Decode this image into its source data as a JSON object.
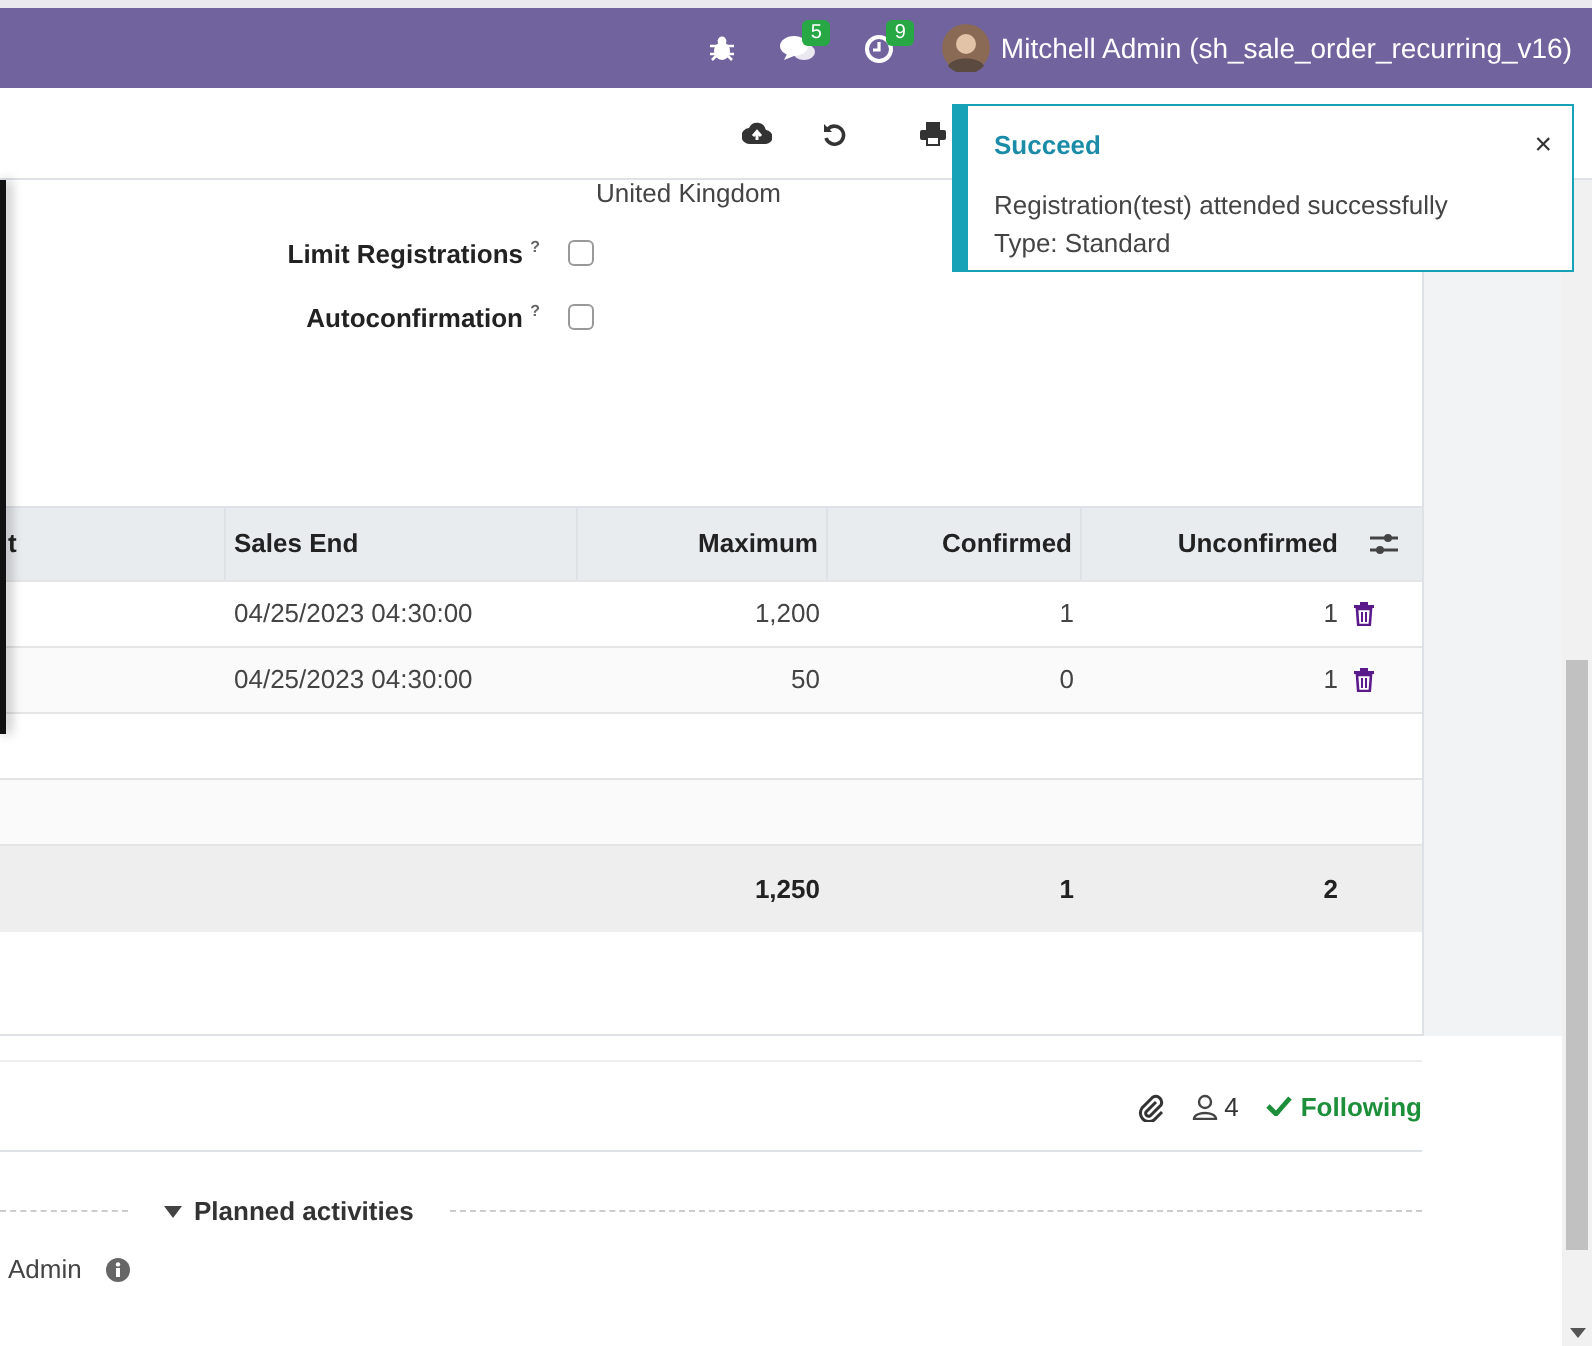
{
  "navbar": {
    "chat_count": "5",
    "activity_count": "9",
    "user": "Mitchell Admin (sh_sale_order_recurring_v16)"
  },
  "form": {
    "country": "United Kingdom",
    "fields": [
      {
        "label": "Limit Registrations $^{?}$",
        "checked": false
      },
      {
        "label": "Autoconfirmation $^{?}$",
        "checked": false
      }
    ]
  },
  "table": {
    "columns": [
      "t",
      "Sales End",
      "Maximum",
      "Confirmed",
      "Unconfirmed"
    ],
    "rows": [
      {
        "sales_end": "04/25/2023 04:30:00",
        "maximum": "1,200",
        "confirmed": "1",
        "unconfirmed": "1"
      },
      {
        "sales_end": "04/25/2023 04:30:00",
        "maximum": "50",
        "confirmed": "0",
        "unconfirmed": "1"
      }
    ],
    "totals": {
      "maximum": "1,250",
      "confirmed": "1",
      "unconfirmed": "2"
    }
  },
  "chatter": {
    "followers": "4",
    "follow_label": "Following",
    "section": "Planned activities",
    "activity_user": "Admin"
  },
  "toast": {
    "title": "Succeed",
    "close": "×",
    "lines": [
      "Registration(test) attended successfully",
      "Type: Standard"
    ]
  }
}
